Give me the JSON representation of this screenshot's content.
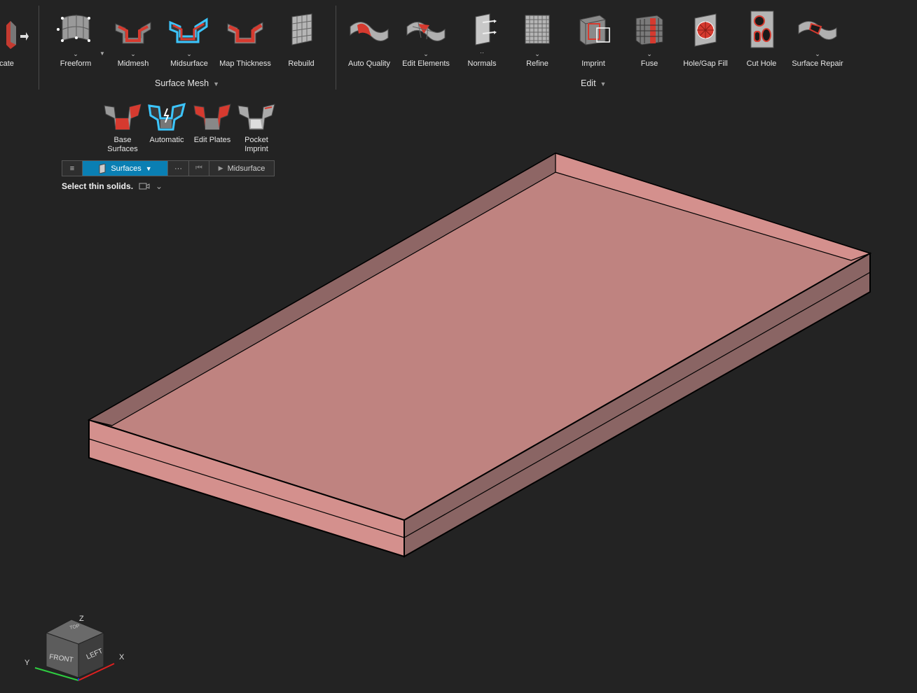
{
  "ribbon": {
    "left_partial_label": "plicate",
    "surface_mesh_tools": [
      {
        "label": "Freeform",
        "icon": "freeform-icon"
      },
      {
        "label": "Midmesh",
        "icon": "midmesh-icon"
      },
      {
        "label": "Midsurface",
        "icon": "midsurface-icon",
        "active": true
      },
      {
        "label": "Map Thickness",
        "icon": "map-thickness-icon"
      },
      {
        "label": "Rebuild",
        "icon": "rebuild-icon"
      }
    ],
    "surface_mesh_group": "Surface Mesh",
    "edit_tools": [
      {
        "label": "Auto Quality",
        "icon": "auto-quality-icon"
      },
      {
        "label": "Edit Elements",
        "icon": "edit-elements-icon"
      },
      {
        "label": "Normals",
        "icon": "normals-icon"
      },
      {
        "label": "Refine",
        "icon": "refine-icon"
      },
      {
        "label": "Imprint",
        "icon": "imprint-icon"
      },
      {
        "label": "Fuse",
        "icon": "fuse-icon"
      },
      {
        "label": "Hole/Gap Fill",
        "icon": "hole-gap-fill-icon"
      },
      {
        "label": "Cut Hole",
        "icon": "cut-hole-icon"
      },
      {
        "label": "Surface Repair",
        "icon": "surface-repair-icon"
      }
    ],
    "edit_group": "Edit"
  },
  "midsurface_tools": [
    {
      "label": "Base Surfaces",
      "line1": "Base",
      "line2": "Surfaces"
    },
    {
      "label": "Automatic",
      "line1": "Automatic",
      "line2": "",
      "active": true
    },
    {
      "label": "Edit Plates",
      "line1": "Edit Plates",
      "line2": ""
    },
    {
      "label": "Pocket Imprint",
      "line1": "Pocket",
      "line2": "Imprint"
    }
  ],
  "guidebar": {
    "selector": "Surfaces",
    "more": "···",
    "run": "Midsurface"
  },
  "prompt": "Select thin solids.",
  "view_cube": {
    "front": "FRONT",
    "left": "LEFT",
    "top": "TOP",
    "x": "X",
    "y": "Y",
    "z": "Z"
  },
  "colors": {
    "background": "#232323",
    "accent_blue": "#0a7fb3",
    "model_top": "#bf8380",
    "model_front": "#d4908d",
    "model_side": "#8a6564",
    "highlight": "#3cc6ff",
    "tool_red": "#d63a2f"
  }
}
